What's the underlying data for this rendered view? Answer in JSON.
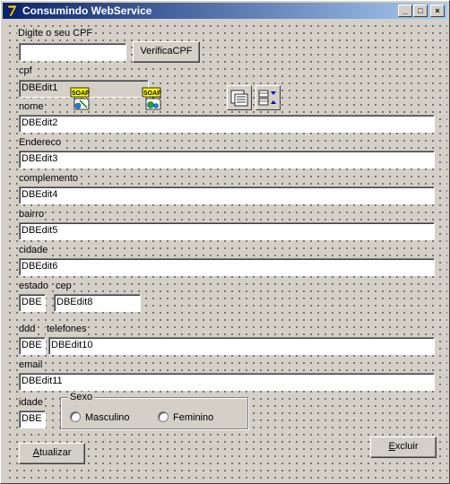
{
  "window": {
    "title": "Consumindo WebService",
    "minimize": "_",
    "maximize": "□",
    "close": "×"
  },
  "form": {
    "cpf_prompt": "Digite o seu CPF",
    "cpf_input_value": "",
    "verify_button": "VerificaCPF",
    "labels": {
      "cpf": "cpf",
      "nome": "nome",
      "endereco": "Endereco",
      "complemento": "complemento",
      "bairro": "bairro",
      "cidade": "cidade",
      "estado": "estado",
      "cep": "cep",
      "ddd": "ddd",
      "telefones": "telefones",
      "email": "email",
      "idade": "idade"
    },
    "fields": {
      "cpf": "DBEdit1",
      "nome": "DBEdit2",
      "endereco": "DBEdit3",
      "complemento": "DBEdit4",
      "bairro": "DBEdit5",
      "cidade": "DBEdit6",
      "estado": "DBE",
      "cep": "DBEdit8",
      "ddd": "DBE",
      "telefones": "DBEdit10",
      "email": "DBEdit11",
      "idade": "DBE"
    },
    "sexo": {
      "title": "Sexo",
      "options": [
        "Masculino",
        "Feminino"
      ]
    },
    "buttons": {
      "atualizar_underlined": "A",
      "atualizar_rest": "tualizar",
      "excluir_underlined": "E",
      "excluir_rest": "xcluir"
    },
    "icons": {
      "soap1": "soap-icon",
      "soap2": "soap-icon",
      "datasource": "datasource-icon",
      "clientdataset": "clientdataset-icon",
      "soap_text": "SOAP"
    }
  }
}
